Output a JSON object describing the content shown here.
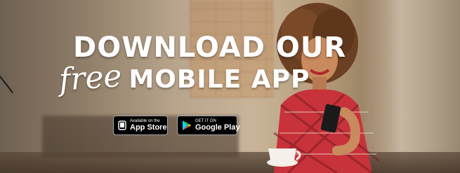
{
  "headline": {
    "line1": "DOWNLOAD OUR",
    "line2_script": "free",
    "line2_bold": "MOBILE APP"
  },
  "badges": {
    "apple": {
      "small": "Available on the",
      "big": "App Store",
      "icon": "apple-icon"
    },
    "google": {
      "small": "GET IT ON",
      "big": "Google Play",
      "icon": "google-play-icon"
    }
  },
  "colors": {
    "headline_text": "#ffffff",
    "badge_background": "#000000",
    "shirt_red": "#c8323a",
    "hair_brown": "#6a3f22"
  }
}
